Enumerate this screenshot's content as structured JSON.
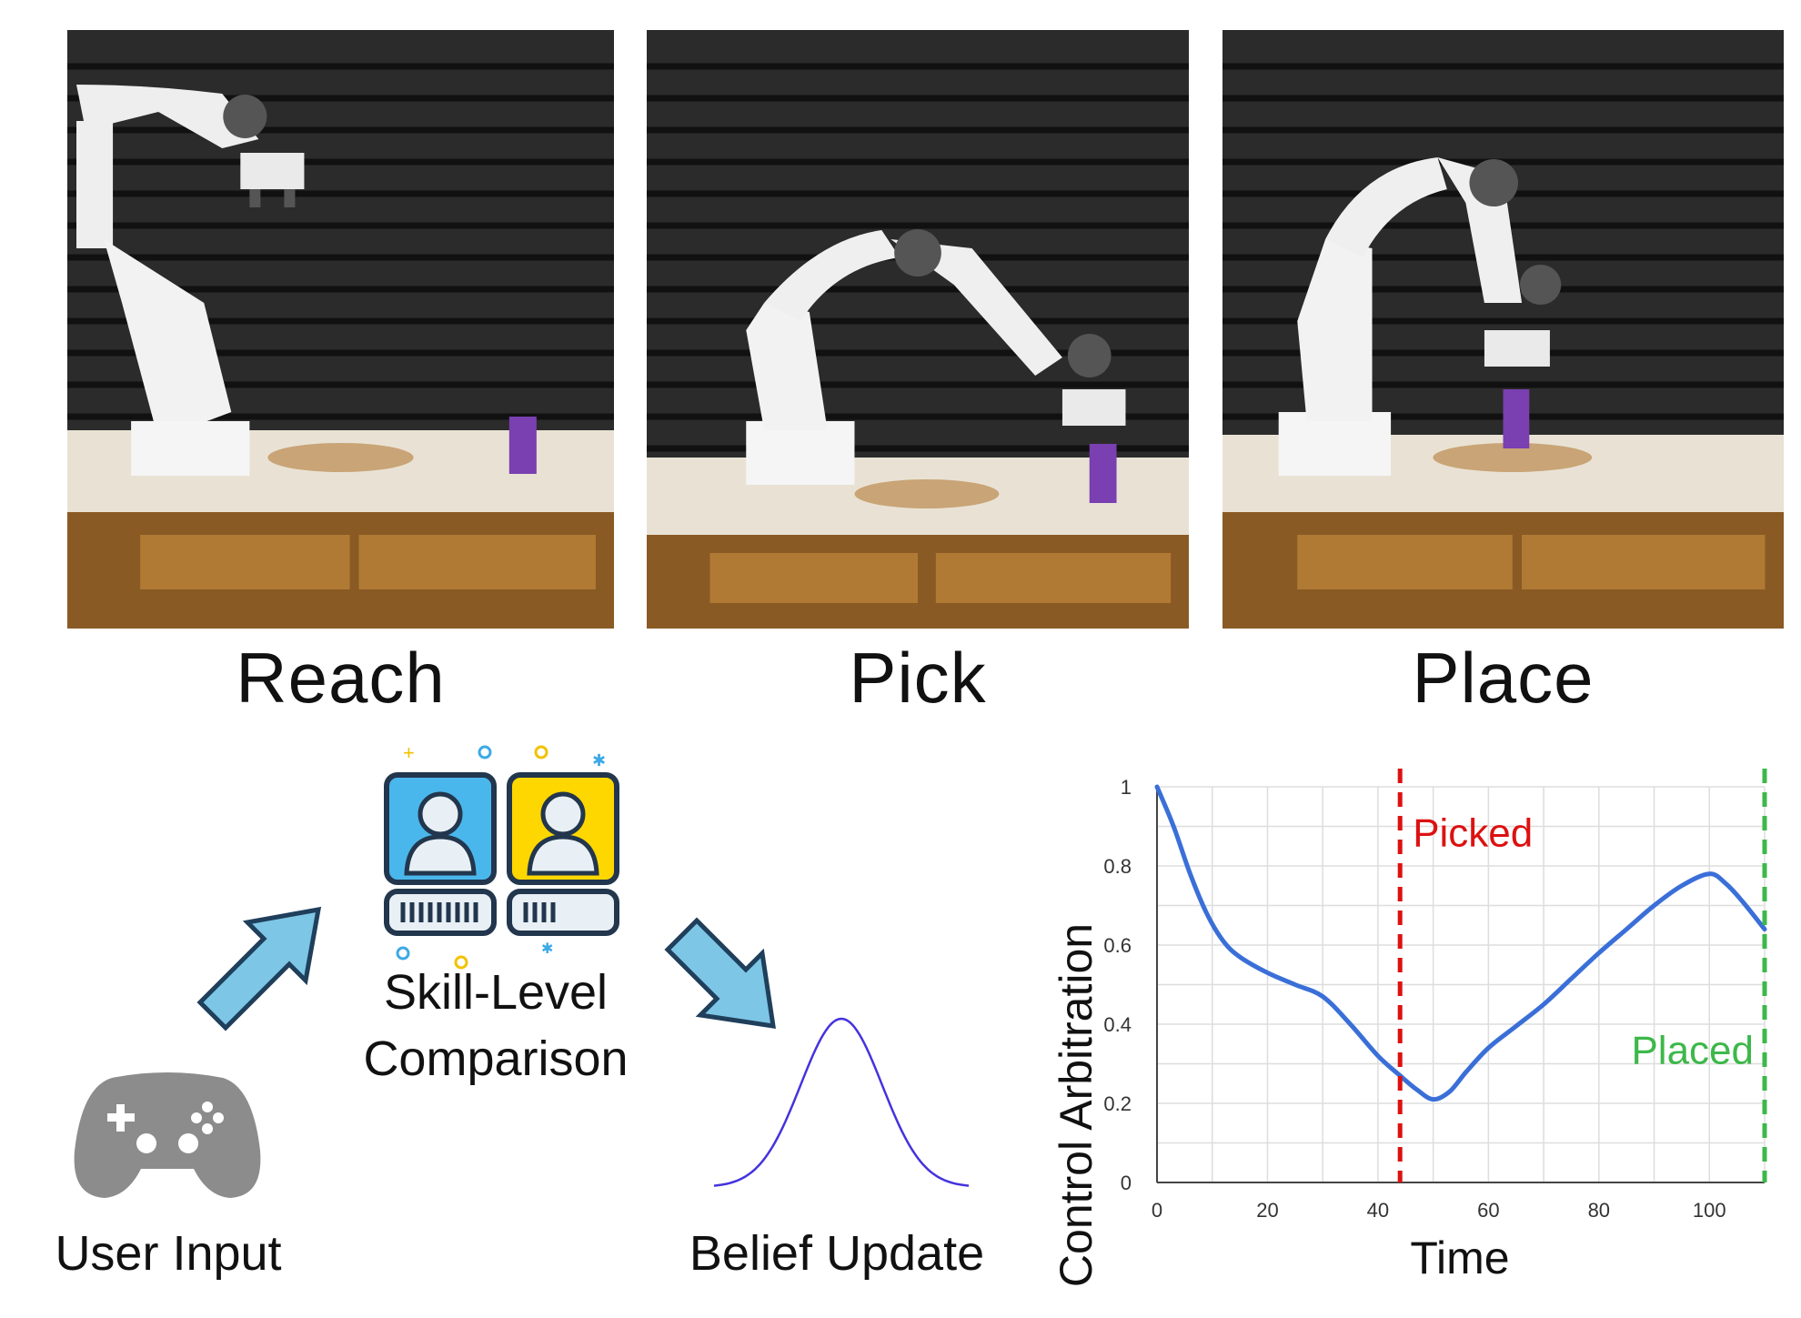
{
  "panels": [
    {
      "caption": "Reach",
      "pose": "reach"
    },
    {
      "caption": "Pick",
      "pose": "pick"
    },
    {
      "caption": "Place",
      "pose": "place"
    }
  ],
  "pipeline": {
    "user_input_label": "User Input",
    "skill_comparison_label_line1": "Skill-Level",
    "skill_comparison_label_line2": "Comparison",
    "belief_update_label": "Belief Update",
    "colors": {
      "arrow": "#7dc6e6",
      "arrow_outline": "#1f3f5b",
      "card_blue": "#4ab7ec",
      "card_yellow": "#ffd700",
      "controller": "#8c8c8c",
      "bell_curve": "#4433dd"
    }
  },
  "chart_data": {
    "type": "line",
    "title": "",
    "xlabel": "Time",
    "ylabel": "Control Arbitration",
    "xlim": [
      0,
      110
    ],
    "ylim": [
      0,
      1
    ],
    "xticks": [
      0,
      20,
      40,
      60,
      80,
      100
    ],
    "yticks": [
      0,
      0.2,
      0.4,
      0.6,
      0.8,
      1
    ],
    "grid": true,
    "series": [
      {
        "color": "#3a6fd8",
        "x": [
          0,
          3,
          6,
          9,
          12,
          15,
          20,
          25,
          30,
          35,
          40,
          44,
          47,
          50,
          53,
          56,
          60,
          65,
          70,
          75,
          80,
          85,
          90,
          95,
          100,
          103,
          106,
          110
        ],
        "y": [
          1.0,
          0.9,
          0.78,
          0.68,
          0.61,
          0.57,
          0.53,
          0.5,
          0.47,
          0.4,
          0.32,
          0.27,
          0.235,
          0.21,
          0.23,
          0.28,
          0.34,
          0.395,
          0.45,
          0.515,
          0.58,
          0.64,
          0.7,
          0.75,
          0.78,
          0.755,
          0.71,
          0.64
        ]
      }
    ],
    "annotations": [
      {
        "text": "Picked",
        "x": 44,
        "color": "#dd1111"
      },
      {
        "text": "Placed",
        "x": 110,
        "color": "#3db84a"
      }
    ]
  }
}
